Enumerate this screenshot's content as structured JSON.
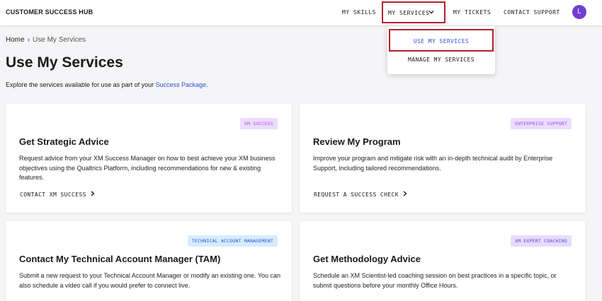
{
  "header": {
    "brand": "CUSTOMER SUCCESS HUB",
    "nav": {
      "skills": "MY SKILLS",
      "services": "MY SERVICES",
      "tickets": "MY TICKETS",
      "support": "CONTACT SUPPORT"
    },
    "avatar_initial": "L"
  },
  "dropdown": {
    "use": "USE MY SERVICES",
    "manage": "MANAGE MY SERVICES"
  },
  "breadcrumb": {
    "home": "Home",
    "separator": "›",
    "current": "Use My Services"
  },
  "page": {
    "title": "Use My Services",
    "intro_prefix": "Explore the services available for use as part of your ",
    "intro_link": "Success Package",
    "intro_suffix": "."
  },
  "cards": [
    {
      "badge": "XM SUCCESS",
      "badge_bg": "#ecdcff",
      "badge_fg": "#b54fe0",
      "title": "Get Strategic Advice",
      "description": "Request advice from your XM Success Manager on how to best achieve your XM business objectives using the Qualtrics Platform, including recommendations for new & existing features.",
      "cta": "CONTACT XM SUCCESS"
    },
    {
      "badge": "ENTERPRISE SUPPORT",
      "badge_bg": "#ecdcff",
      "badge_fg": "#a04fd8",
      "title": "Review My Program",
      "description": "Improve your program and mitigate risk with an in-depth technical audit by Enterprise Support, including tailored recommendations.",
      "cta": "REQUEST A SUCCESS CHECK"
    },
    {
      "badge": "TECHNICAL ACCOUNT MANAGEMENT",
      "badge_bg": "#d6ecff",
      "badge_fg": "#2d4fd6",
      "title": "Contact My Technical Account Manager (TAM)",
      "description": "Submit a new request to your Technical Account Manager or modify an existing one. You can also schedule a video call if you would prefer to connect live."
    },
    {
      "badge": "XM EXPERT COACHING",
      "badge_bg": "#e6dcff",
      "badge_fg": "#6a3fc8",
      "title": "Get Methodology Advice",
      "description": "Schedule an XM Scientist-led coaching session on best practices in a specific topic, or submit questions before your monthly Office Hours."
    }
  ],
  "icons": {
    "chevron": "chevron-down-icon",
    "arrow": "chevron-right-icon"
  },
  "colors": {
    "accent": "#2d4fd6",
    "highlight": "#b3202a",
    "avatar": "#6f3fd1"
  }
}
